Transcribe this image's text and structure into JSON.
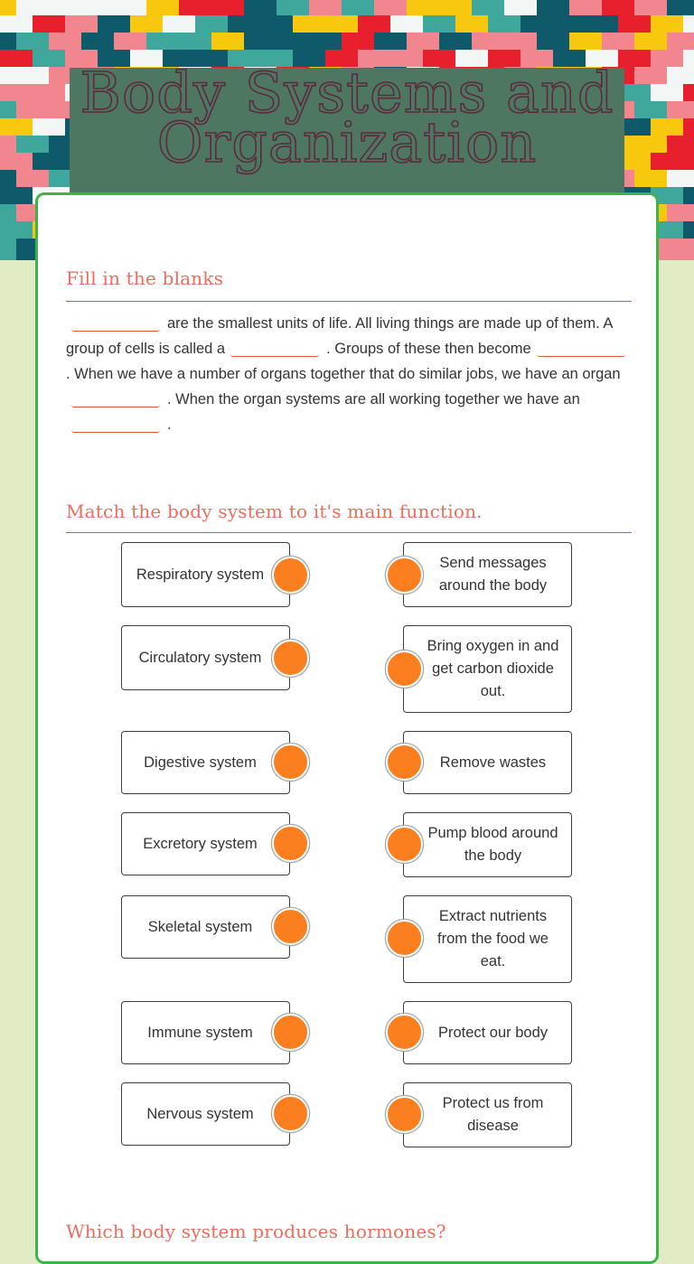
{
  "page": {
    "title_line1": "Body Systems and",
    "title_line2": "Organization",
    "colors": {
      "background": "#e2ecc4",
      "card_border": "#3db44a",
      "banner": "#4e7761",
      "title_ink": "#5b2a3e",
      "section_title": "#f06b5c",
      "accent_rule": "#e8533f",
      "match_dot": "#fb7f1f"
    },
    "pattern_colors": [
      "#0e5a6b",
      "#3fa79b",
      "#f2868f",
      "#e8202d",
      "#f8c80f",
      "#f2f6f4"
    ]
  },
  "fill_blanks": {
    "title": "Fill in the blanks",
    "segments": [
      {
        "type": "blank"
      },
      {
        "type": "text",
        "text": "are the smallest units of life. All living things are made up of them. A group of cells is called a"
      },
      {
        "type": "blank"
      },
      {
        "type": "text",
        "text": ". Groups of these then become"
      },
      {
        "type": "blank"
      },
      {
        "type": "text",
        "text": ". When we have a number of organs together that do similar jobs, we have an organ"
      },
      {
        "type": "blank"
      },
      {
        "type": "text",
        "text": ". When the organ systems are all working together we have an"
      },
      {
        "type": "blank"
      },
      {
        "type": "text",
        "text": "."
      }
    ]
  },
  "matching": {
    "title": "Match the body system to it's main function.",
    "left": [
      "Respiratory system",
      "Circulatory system",
      "Digestive system",
      "Excretory system",
      "Skeletal system",
      "Immune system",
      "Nervous system"
    ],
    "right": [
      "Send messages around the body",
      "Bring oxygen in and get carbon dioxide out.",
      "Remove wastes",
      "Pump blood around the body",
      "Extract nutrients from the food we eat.",
      "Protect our body",
      "Protect us from disease"
    ]
  },
  "question3": {
    "title": "Which body system produces hormones?"
  }
}
